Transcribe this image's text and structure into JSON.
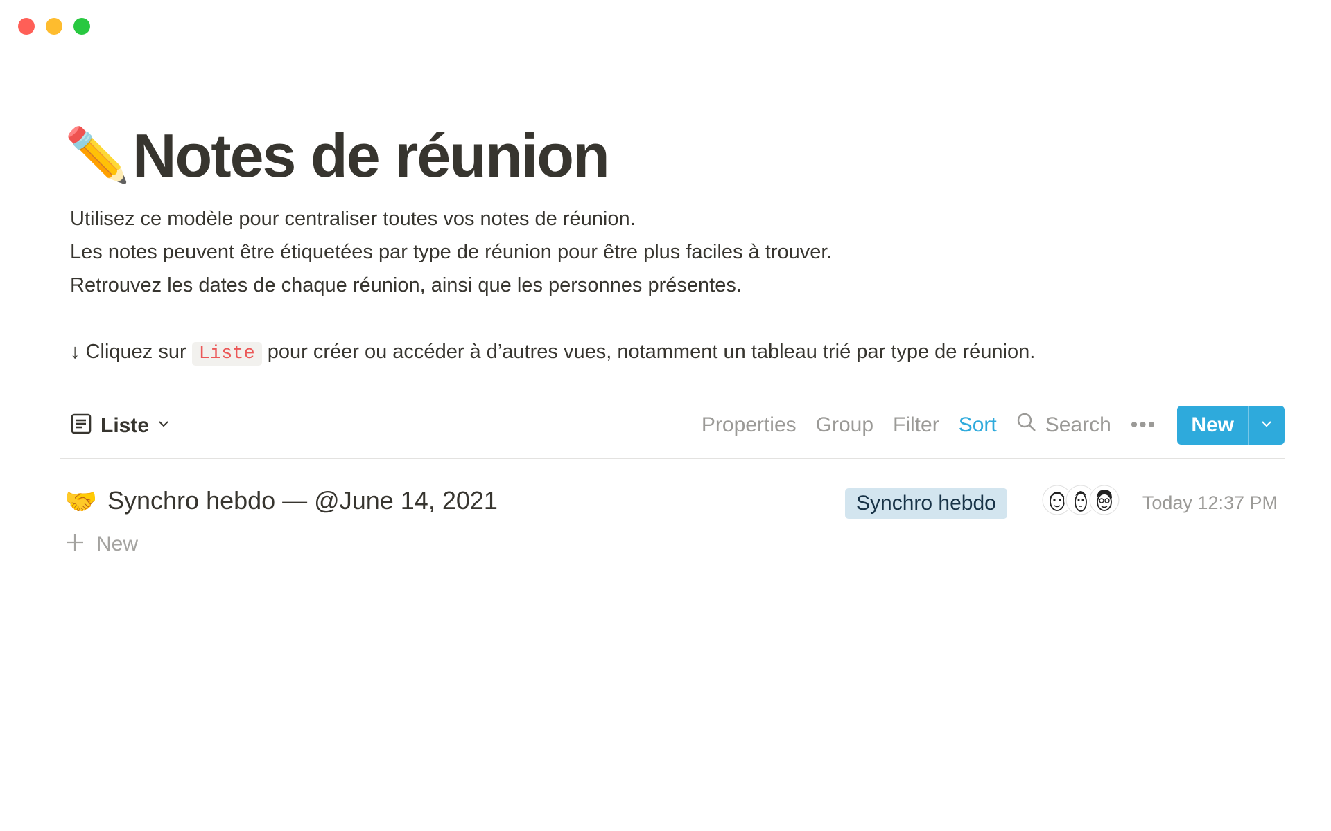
{
  "window": {
    "controls": [
      "close",
      "minimize",
      "zoom"
    ]
  },
  "page": {
    "icon": "✏️",
    "title": "Notes de réunion",
    "description": [
      "Utilisez ce modèle pour centraliser toutes vos notes de réunion.",
      "Les notes peuvent être étiquetées par type de réunion pour être plus faciles à trouver.",
      "Retrouvez les dates de chaque réunion, ainsi que les personnes présentes."
    ],
    "hint": {
      "prefix": "↓ Cliquez sur",
      "code": "Liste",
      "suffix": "pour créer ou accéder à d’autres vues, notamment un tableau trié par type de réunion."
    }
  },
  "toolbar": {
    "view_label": "Liste",
    "view_icon": "list-view-icon",
    "properties": "Properties",
    "group": "Group",
    "filter": "Filter",
    "sort": "Sort",
    "search": "Search",
    "more": "•••",
    "new": "New",
    "accent": "#2eaadc"
  },
  "rows": [
    {
      "icon": "🤝",
      "title": "Synchro hebdo — @June 14, 2021",
      "tag": "Synchro hebdo",
      "tag_color": "#d3e5ef",
      "attendees": [
        "avatar-1",
        "avatar-2",
        "avatar-3"
      ],
      "date": "Today 12:37 PM"
    }
  ],
  "add_row": {
    "label": "New"
  }
}
